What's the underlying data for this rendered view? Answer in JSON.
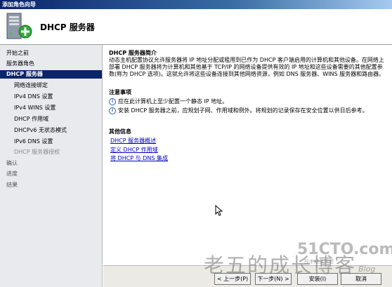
{
  "window": {
    "title": "添加角色向导"
  },
  "header": {
    "title": "DHCP 服务器",
    "icon": "server-add-icon"
  },
  "sidebar": {
    "items": [
      {
        "label": "开始之前",
        "state": "normal",
        "level": 0
      },
      {
        "label": "服务器角色",
        "state": "normal",
        "level": 0
      },
      {
        "label": "DHCP 服务器",
        "state": "active",
        "level": 0
      },
      {
        "label": "网络连接绑定",
        "state": "normal",
        "level": 1
      },
      {
        "label": "IPv4 DNS 设置",
        "state": "normal",
        "level": 1
      },
      {
        "label": "IPv4 WINS 设置",
        "state": "normal",
        "level": 1
      },
      {
        "label": "DHCP 作用域",
        "state": "normal",
        "level": 1
      },
      {
        "label": "DHCPv6 无状态模式",
        "state": "normal",
        "level": 1
      },
      {
        "label": "IPv6 DNS 设置",
        "state": "normal",
        "level": 1
      },
      {
        "label": "DHCP 服务器授权",
        "state": "disabled",
        "level": 1
      },
      {
        "label": "确认",
        "state": "dim",
        "level": 0
      },
      {
        "label": "进度",
        "state": "dim",
        "level": 0
      },
      {
        "label": "结果",
        "state": "dim",
        "level": 0
      }
    ]
  },
  "content": {
    "intro_title": "DHCP 服务器简介",
    "intro_text": "动态主机配置协议允许服务器将 IP 地址分配或租用到已作为 DHCP 客户端启用的计算机和其他设备。在网络上部署 DHCP 服务器将为计算机和其他基于 TCP/IP 的网络设备提供有效的 IP 地址和这些设备需要的其他配置参数(称为 DHCP 选项)。这就允许将这些设备连接到其他网络资源，例如 DNS 服务器、WINS 服务器和路由器。",
    "notes_title": "注意事项",
    "notes": [
      "应在此计算机上至少配置一个静态 IP 地址。",
      "安装 DHCP 服务器之前，应规划子网、作用域和例外。将规划的记录保存在安全位置以供日后参考。"
    ],
    "info_title": "其他信息",
    "links": [
      "DHCP 服务器概述",
      "定义 DHCP 作用域",
      "将 DHCP 与 DNS 集成"
    ]
  },
  "footer": {
    "back": "< 上一步(P)",
    "next": "下一步(N) >",
    "install": "安装(I)",
    "cancel": "取消"
  },
  "watermark": {
    "text": "老五的成长博客",
    "brand": "51CTO.com",
    "sub": "技术成就梦想",
    "blog": "Blog"
  }
}
